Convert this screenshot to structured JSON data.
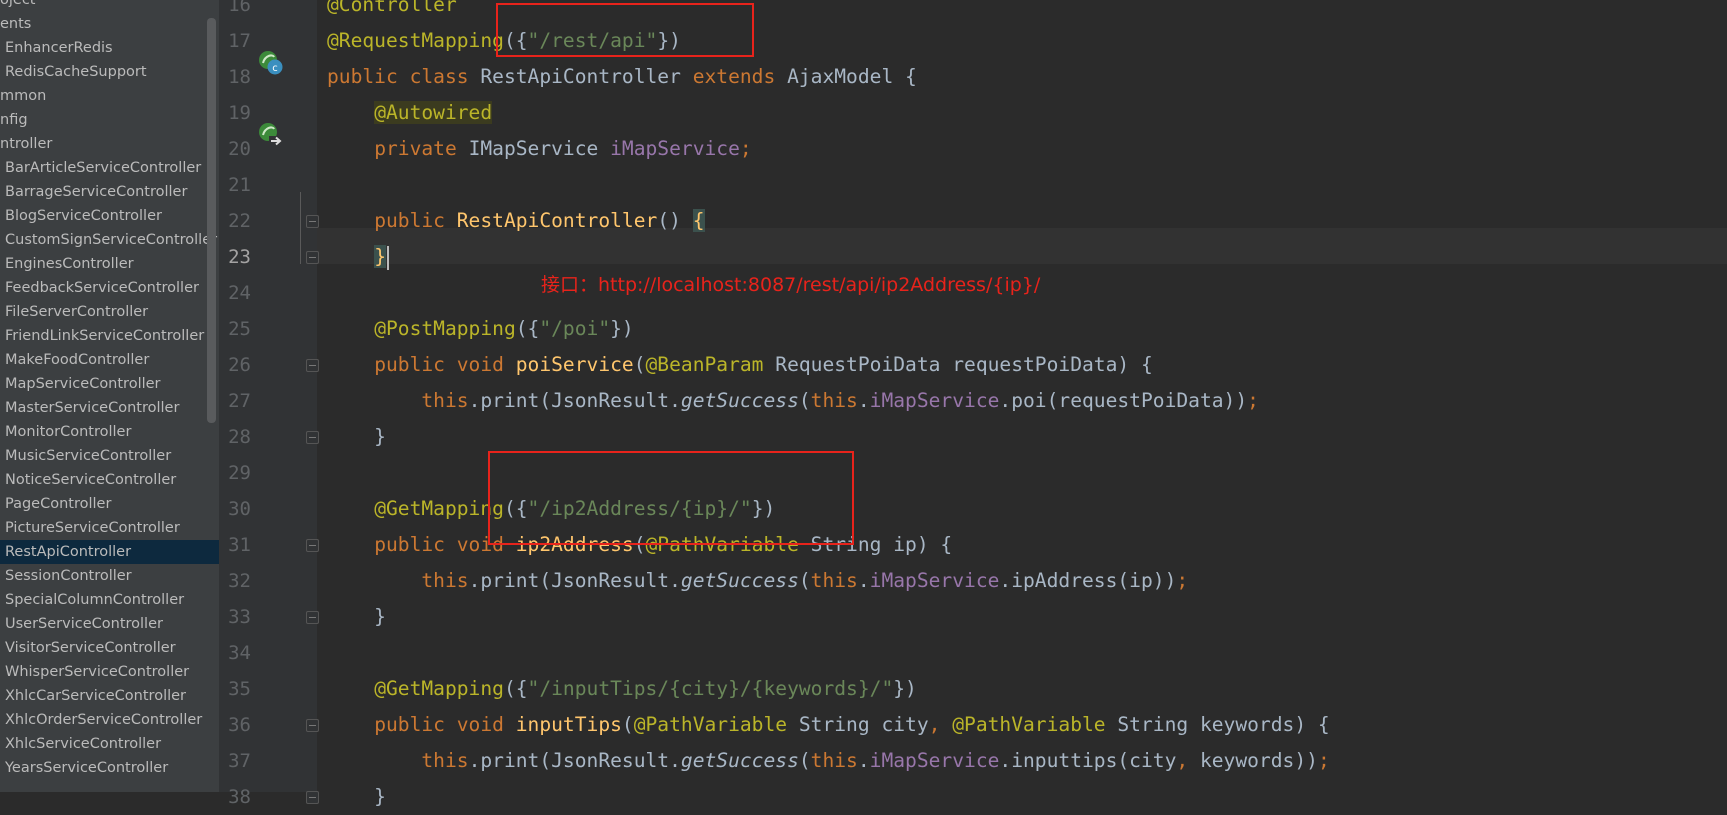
{
  "sidebar": {
    "items": [
      {
        "label": "oject",
        "indent": 0
      },
      {
        "label": "ents",
        "indent": 0
      },
      {
        "label": "EnhancerRedis",
        "indent": 1
      },
      {
        "label": "RedisCacheSupport",
        "indent": 1
      },
      {
        "label": "mmon",
        "indent": 0
      },
      {
        "label": "nfig",
        "indent": 0
      },
      {
        "label": "ntroller",
        "indent": 0
      },
      {
        "label": "BarArticleServiceController",
        "indent": 1
      },
      {
        "label": "BarrageServiceController",
        "indent": 1
      },
      {
        "label": "BlogServiceController",
        "indent": 1
      },
      {
        "label": "CustomSignServiceController",
        "indent": 1
      },
      {
        "label": "EnginesController",
        "indent": 1
      },
      {
        "label": "FeedbackServiceController",
        "indent": 1
      },
      {
        "label": "FileServerController",
        "indent": 1
      },
      {
        "label": "FriendLinkServiceController",
        "indent": 1
      },
      {
        "label": "MakeFoodController",
        "indent": 1
      },
      {
        "label": "MapServiceController",
        "indent": 1
      },
      {
        "label": "MasterServiceController",
        "indent": 1
      },
      {
        "label": "MonitorController",
        "indent": 1
      },
      {
        "label": "MusicServiceController",
        "indent": 1
      },
      {
        "label": "NoticeServiceController",
        "indent": 1
      },
      {
        "label": "PageController",
        "indent": 1
      },
      {
        "label": "PictureServiceController",
        "indent": 1
      },
      {
        "label": "RestApiController",
        "indent": 1,
        "selected": true
      },
      {
        "label": "SessionController",
        "indent": 1
      },
      {
        "label": "SpecialColumnController",
        "indent": 1
      },
      {
        "label": "UserServiceController",
        "indent": 1
      },
      {
        "label": "VisitorServiceController",
        "indent": 1
      },
      {
        "label": "WhisperServiceController",
        "indent": 1
      },
      {
        "label": "XhlcCarServiceController",
        "indent": 1
      },
      {
        "label": "XhlcOrderServiceController",
        "indent": 1
      },
      {
        "label": "XhlcServiceController",
        "indent": 1
      },
      {
        "label": "YearsServiceController",
        "indent": 1
      }
    ]
  },
  "editor": {
    "line_numbers": [
      "16",
      "17",
      "18",
      "19",
      "20",
      "21",
      "22",
      "23",
      "24",
      "25",
      "26",
      "27",
      "28",
      "29",
      "30",
      "31",
      "32",
      "33",
      "34",
      "35",
      "36",
      "37",
      "38"
    ],
    "active_line": "23",
    "lines": [
      [
        {
          "t": "@Controller",
          "c": "ann"
        }
      ],
      [
        {
          "t": "@RequestMapping",
          "c": "ann"
        },
        {
          "t": "({",
          "c": ""
        },
        {
          "t": "\"/rest/api\"",
          "c": "str"
        },
        {
          "t": "})",
          "c": ""
        }
      ],
      [
        {
          "t": "public class ",
          "c": "kw"
        },
        {
          "t": "RestApiController ",
          "c": ""
        },
        {
          "t": "extends ",
          "c": "kw"
        },
        {
          "t": "AjaxModel {",
          "c": ""
        }
      ],
      [
        {
          "t": "    ",
          "c": ""
        },
        {
          "t": "@Autowired",
          "c": "ann hl-ann"
        }
      ],
      [
        {
          "t": "    ",
          "c": ""
        },
        {
          "t": "private ",
          "c": "kw"
        },
        {
          "t": "IMapService ",
          "c": ""
        },
        {
          "t": "iMapService",
          "c": "fld"
        },
        {
          "t": ";",
          "c": "kw"
        }
      ],
      [],
      [
        {
          "t": "    ",
          "c": ""
        },
        {
          "t": "public ",
          "c": "kw"
        },
        {
          "t": "RestApiController",
          "c": "fn"
        },
        {
          "t": "() ",
          "c": ""
        },
        {
          "t": "{",
          "c": "fn brace-hl"
        }
      ],
      [
        {
          "t": "    ",
          "c": ""
        },
        {
          "t": "}",
          "c": "fn brace-hl"
        }
      ],
      [],
      [
        {
          "t": "    ",
          "c": ""
        },
        {
          "t": "@PostMapping",
          "c": "ann"
        },
        {
          "t": "({",
          "c": ""
        },
        {
          "t": "\"/poi\"",
          "c": "str"
        },
        {
          "t": "})",
          "c": ""
        }
      ],
      [
        {
          "t": "    ",
          "c": ""
        },
        {
          "t": "public void ",
          "c": "kw"
        },
        {
          "t": "poiService",
          "c": "fn"
        },
        {
          "t": "(",
          "c": ""
        },
        {
          "t": "@BeanParam ",
          "c": "ann"
        },
        {
          "t": "RequestPoiData requestPoiData) {",
          "c": ""
        }
      ],
      [
        {
          "t": "        ",
          "c": ""
        },
        {
          "t": "this",
          "c": "kw"
        },
        {
          "t": ".print(JsonResult.",
          "c": ""
        },
        {
          "t": "getSuccess",
          "c": "it"
        },
        {
          "t": "(",
          "c": ""
        },
        {
          "t": "this",
          "c": "kw"
        },
        {
          "t": ".",
          "c": ""
        },
        {
          "t": "iMapService",
          "c": "fld"
        },
        {
          "t": ".poi(requestPoiData))",
          "c": ""
        },
        {
          "t": ";",
          "c": "kw"
        }
      ],
      [
        {
          "t": "    }",
          "c": ""
        }
      ],
      [],
      [
        {
          "t": "    ",
          "c": ""
        },
        {
          "t": "@GetMapping",
          "c": "ann"
        },
        {
          "t": "({",
          "c": ""
        },
        {
          "t": "\"/ip2Address/{ip}/\"",
          "c": "str"
        },
        {
          "t": "})",
          "c": ""
        }
      ],
      [
        {
          "t": "    ",
          "c": ""
        },
        {
          "t": "public void ",
          "c": "kw"
        },
        {
          "t": "ip2Address",
          "c": "fn"
        },
        {
          "t": "(",
          "c": ""
        },
        {
          "t": "@PathVariable ",
          "c": "ann"
        },
        {
          "t": "String ip) {",
          "c": ""
        }
      ],
      [
        {
          "t": "        ",
          "c": ""
        },
        {
          "t": "this",
          "c": "kw"
        },
        {
          "t": ".print(JsonResult.",
          "c": ""
        },
        {
          "t": "getSuccess",
          "c": "it"
        },
        {
          "t": "(",
          "c": ""
        },
        {
          "t": "this",
          "c": "kw"
        },
        {
          "t": ".",
          "c": ""
        },
        {
          "t": "iMapService",
          "c": "fld"
        },
        {
          "t": ".ipAddress(ip))",
          "c": ""
        },
        {
          "t": ";",
          "c": "kw"
        }
      ],
      [
        {
          "t": "    }",
          "c": ""
        }
      ],
      [],
      [
        {
          "t": "    ",
          "c": ""
        },
        {
          "t": "@GetMapping",
          "c": "ann"
        },
        {
          "t": "({",
          "c": ""
        },
        {
          "t": "\"/inputTips/{city}/{keywords}/\"",
          "c": "str"
        },
        {
          "t": "})",
          "c": ""
        }
      ],
      [
        {
          "t": "    ",
          "c": ""
        },
        {
          "t": "public void ",
          "c": "kw"
        },
        {
          "t": "inputTips",
          "c": "fn"
        },
        {
          "t": "(",
          "c": ""
        },
        {
          "t": "@PathVariable ",
          "c": "ann"
        },
        {
          "t": "String city",
          "c": ""
        },
        {
          "t": ", ",
          "c": "kw"
        },
        {
          "t": "@PathVariable ",
          "c": "ann"
        },
        {
          "t": "String keywords) {",
          "c": ""
        }
      ],
      [
        {
          "t": "        ",
          "c": ""
        },
        {
          "t": "this",
          "c": "kw"
        },
        {
          "t": ".print(JsonResult.",
          "c": ""
        },
        {
          "t": "getSuccess",
          "c": "it"
        },
        {
          "t": "(",
          "c": ""
        },
        {
          "t": "this",
          "c": "kw"
        },
        {
          "t": ".",
          "c": ""
        },
        {
          "t": "iMapService",
          "c": "fld"
        },
        {
          "t": ".inputtips(city",
          "c": ""
        },
        {
          "t": ", ",
          "c": "kw"
        },
        {
          "t": "keywords))",
          "c": ""
        },
        {
          "t": ";",
          "c": "kw"
        }
      ],
      [
        {
          "t": "    }",
          "c": ""
        }
      ]
    ]
  },
  "annotation": {
    "caption": "接口：http://localhost:8087/rest/api/ip2Address/{ip}/"
  },
  "colors": {
    "background": "#2b2b2b",
    "keyword": "#cc7832",
    "annotation": "#bbb529",
    "string": "#6a8759",
    "field": "#9876aa",
    "method": "#ffc66d",
    "highlight_box": "#e8231b",
    "selected_row": "#0d293e"
  }
}
